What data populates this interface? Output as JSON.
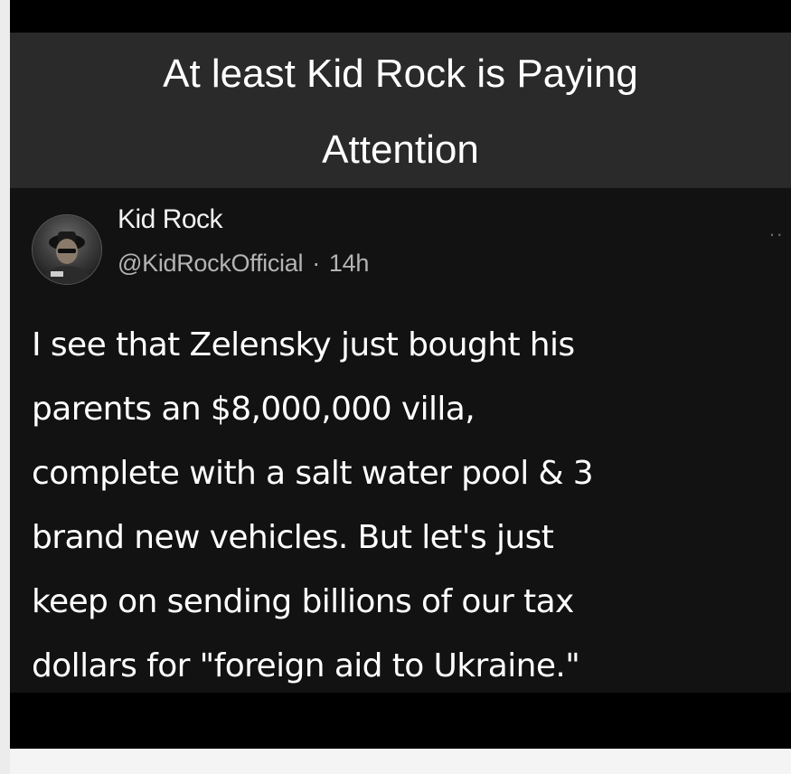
{
  "caption": {
    "line1": "At least Kid Rock is Paying",
    "line2": "Attention"
  },
  "tweet": {
    "author_name": "Kid Rock",
    "handle": "@KidRockOfficial",
    "separator": "·",
    "time": "14h",
    "more_label": "··",
    "lines": [
      "I see that Zelensky just bought his",
      "parents an $8,000,000 villa,",
      "complete with a salt water pool & 3",
      "brand new vehicles. But let's just",
      "keep on sending billions of our tax",
      "dollars for \"foreign aid to Ukraine.\""
    ]
  },
  "colors": {
    "background": "#000000",
    "caption_bg": "#2a2a2a",
    "tweet_bg": "#121212",
    "text_primary": "#ffffff",
    "text_secondary": "#b4b4b4"
  },
  "icons": {
    "avatar": "profile-photo",
    "more": "more-dots-icon"
  }
}
